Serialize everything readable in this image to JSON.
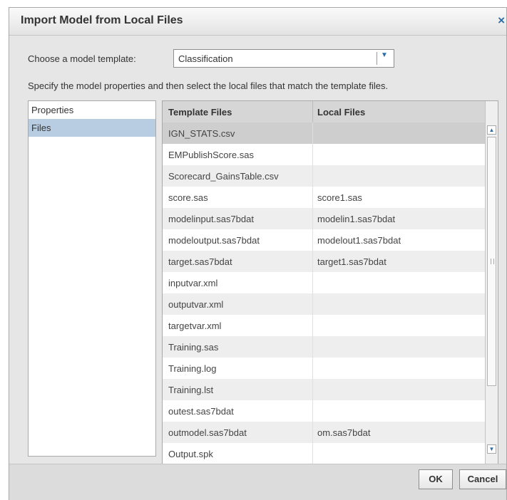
{
  "dialog": {
    "title": "Import Model from Local Files",
    "close_icon": "×"
  },
  "template": {
    "label": "Choose a model template:",
    "value": "Classification",
    "dropdown_icon": "▼"
  },
  "instructions": "Specify the model properties and then select the local files that match the template files.",
  "nav": {
    "items": [
      {
        "label": "Properties"
      },
      {
        "label": "Files",
        "selected": true
      }
    ]
  },
  "grid": {
    "headers": {
      "template": "Template Files",
      "local": "Local Files"
    },
    "rows": [
      {
        "template": "IGN_STATS.csv",
        "local": ""
      },
      {
        "template": "EMPublishScore.sas",
        "local": ""
      },
      {
        "template": "Scorecard_GainsTable.csv",
        "local": ""
      },
      {
        "template": "score.sas",
        "local": "score1.sas"
      },
      {
        "template": "modelinput.sas7bdat",
        "local": "modelin1.sas7bdat"
      },
      {
        "template": "modeloutput.sas7bdat",
        "local": "modelout1.sas7bdat"
      },
      {
        "template": "target.sas7bdat",
        "local": "target1.sas7bdat"
      },
      {
        "template": "inputvar.xml",
        "local": ""
      },
      {
        "template": "outputvar.xml",
        "local": ""
      },
      {
        "template": "targetvar.xml",
        "local": ""
      },
      {
        "template": "Training.sas",
        "local": ""
      },
      {
        "template": "Training.log",
        "local": ""
      },
      {
        "template": "Training.lst",
        "local": ""
      },
      {
        "template": "outest.sas7bdat",
        "local": ""
      },
      {
        "template": "outmodel.sas7bdat",
        "local": "om.sas7bdat"
      },
      {
        "template": "Output.spk",
        "local": ""
      }
    ],
    "scroll": {
      "up_icon": "▲",
      "down_icon": "▼"
    }
  },
  "footer": {
    "ok": "OK",
    "cancel": "Cancel"
  },
  "colors": {
    "accent": "#2e6da4",
    "selection": "#b8cde2"
  }
}
